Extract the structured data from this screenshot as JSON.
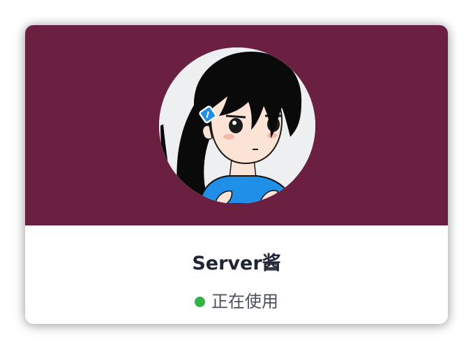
{
  "profile": {
    "name": "Server酱",
    "status_text": "正在使用"
  },
  "icons": {
    "status_indicator": "online-dot"
  },
  "colors": {
    "banner": "#6b2042",
    "status_online": "#2fb344",
    "name_text": "#1f2533",
    "status_text": "#4a4f5a"
  }
}
